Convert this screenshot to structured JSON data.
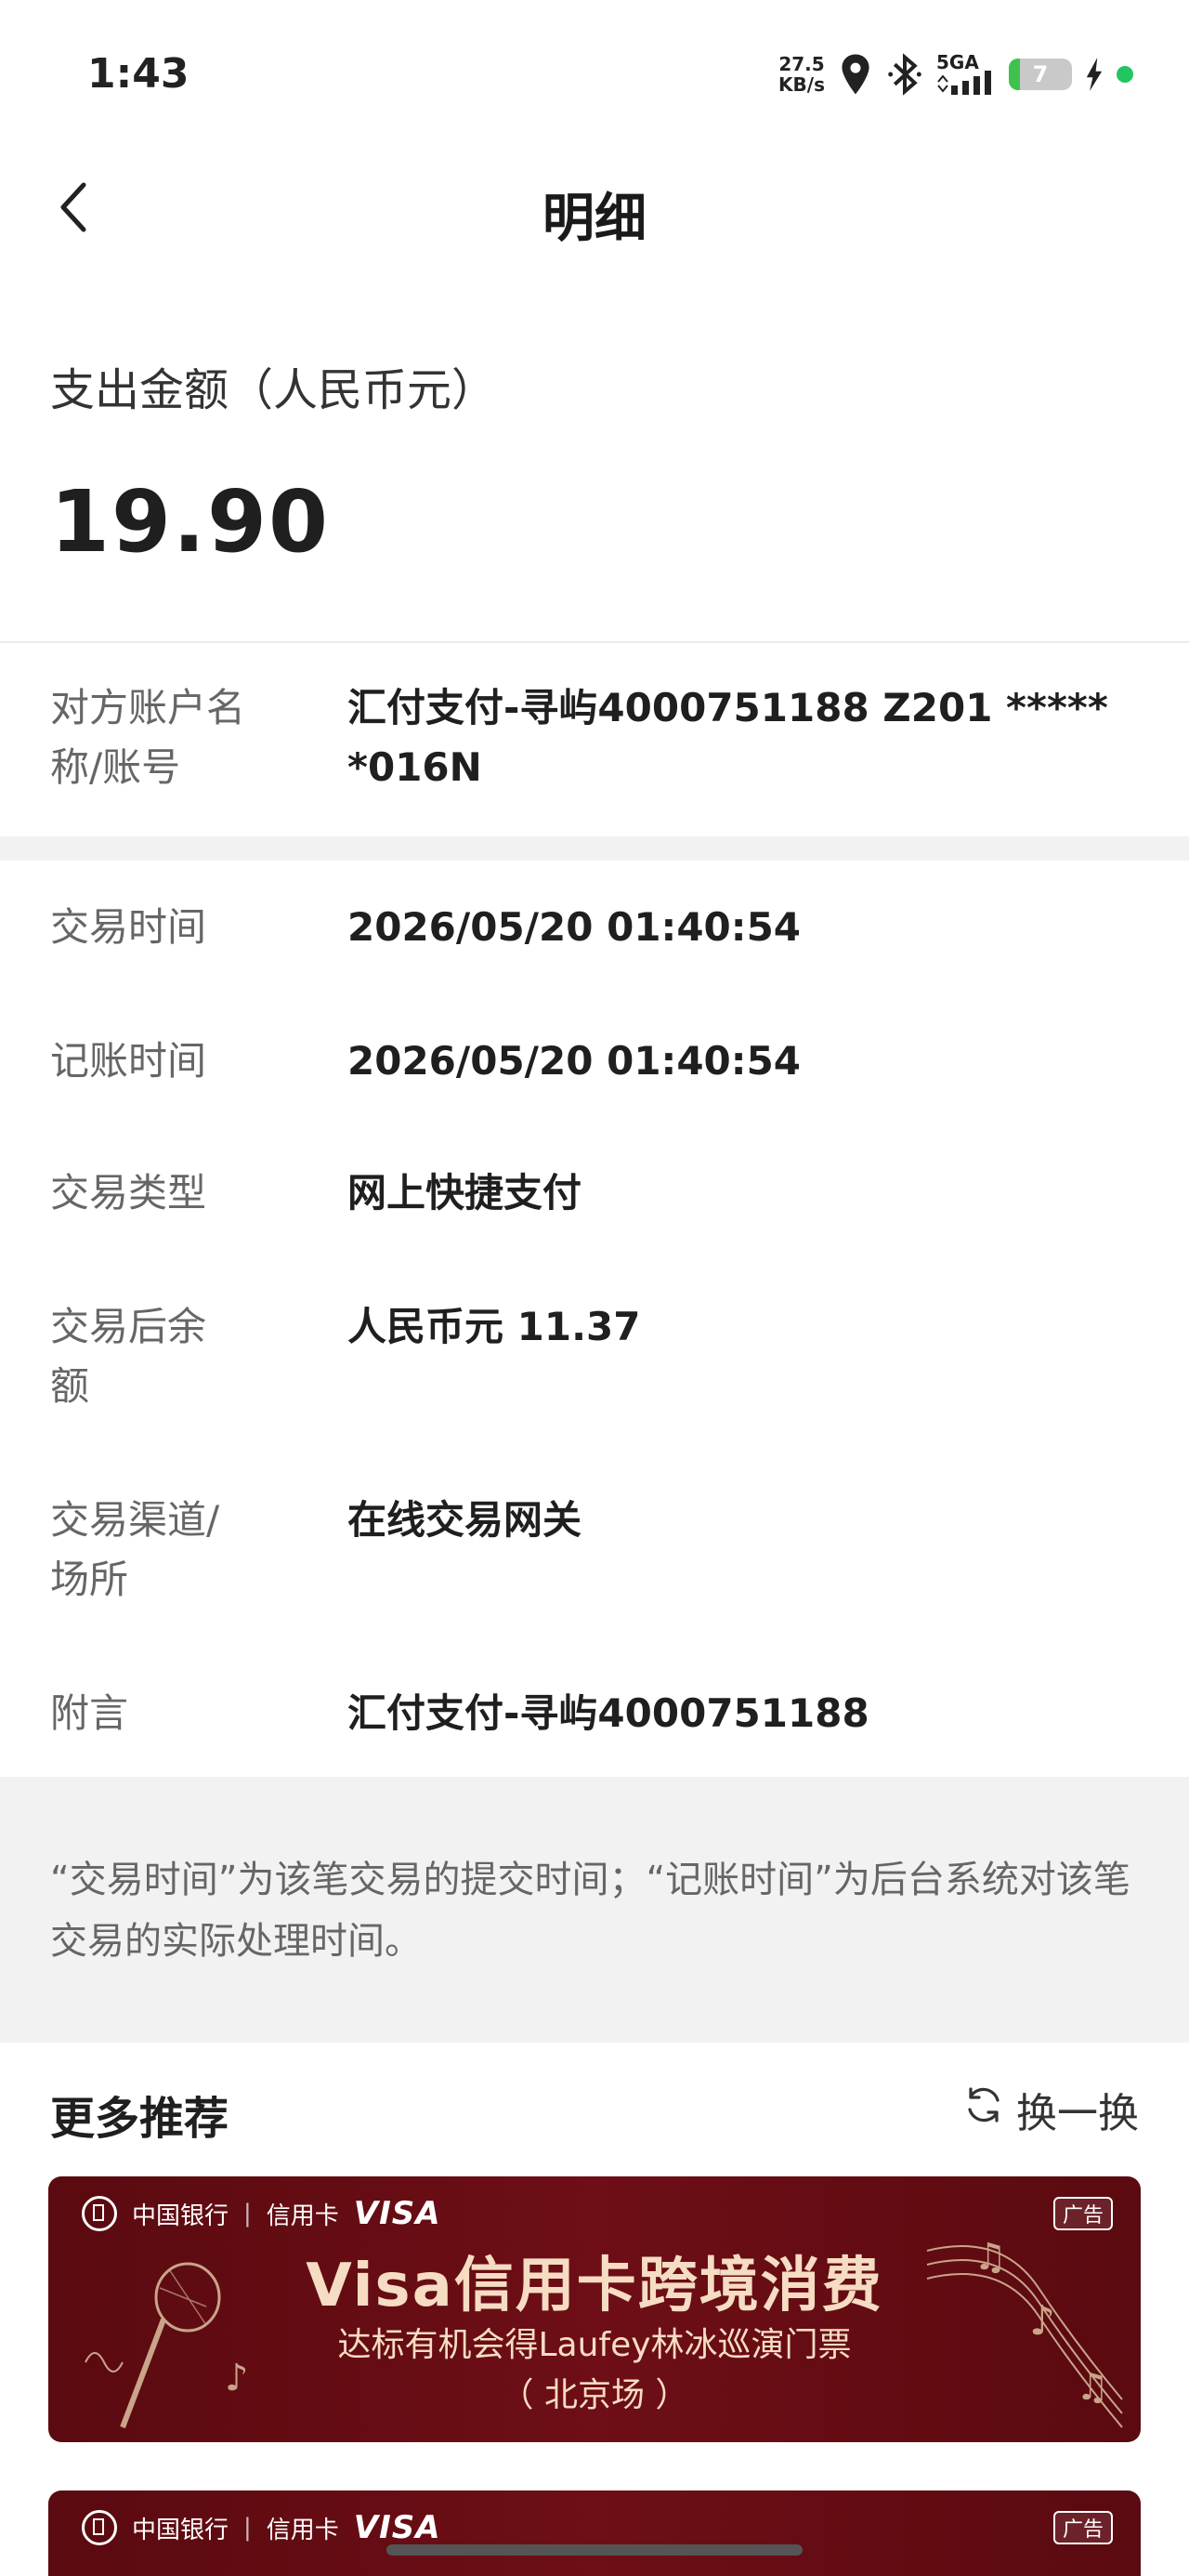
{
  "status_bar": {
    "time": "1:43",
    "net_speed_value": "27.5",
    "net_speed_unit": "KB/s",
    "network": "5GA",
    "battery": "7"
  },
  "header": {
    "title": "明细"
  },
  "amount": {
    "label": "支出金额（人民币元）",
    "value": "19.90"
  },
  "counterparty": {
    "label": "对方账户名称/账号",
    "value": "汇付支付-寻屿4000751188 Z201 ******016N"
  },
  "details": [
    {
      "label": "交易时间",
      "value": "2026/05/20 01:40:54"
    },
    {
      "label": "记账时间",
      "value": "2026/05/20 01:40:54"
    },
    {
      "label": "交易类型",
      "value": "网上快捷支付"
    },
    {
      "label": "交易后余额",
      "value": "人民币元 11.37"
    },
    {
      "label": "交易渠道/场所",
      "value": "在线交易网关"
    },
    {
      "label": "附言",
      "value": "汇付支付-寻屿4000751188"
    }
  ],
  "note": "“交易时间”为该笔交易的提交时间；“记账时间”为后台系统对该笔交易的实际处理时间。",
  "recommendations": {
    "title": "更多推荐",
    "refresh_label": "换一换",
    "banners": [
      {
        "bank_name": "中国银行",
        "card_label": "信用卡",
        "brand": "VISA",
        "ad_tag": "广告",
        "headline": "Visa信用卡跨境消费",
        "subline": "达标有机会得Laufey林冰巡演门票",
        "city": "（ 北京场 ）"
      },
      {
        "bank_name": "中国银行",
        "card_label": "信用卡",
        "brand": "VISA",
        "ad_tag": "广告"
      }
    ]
  },
  "colors": {
    "banner_bg": "#5a0a10",
    "banner_text": "#f5dcc3",
    "muted_text": "#666666",
    "band_bg": "#f2f2f2"
  }
}
